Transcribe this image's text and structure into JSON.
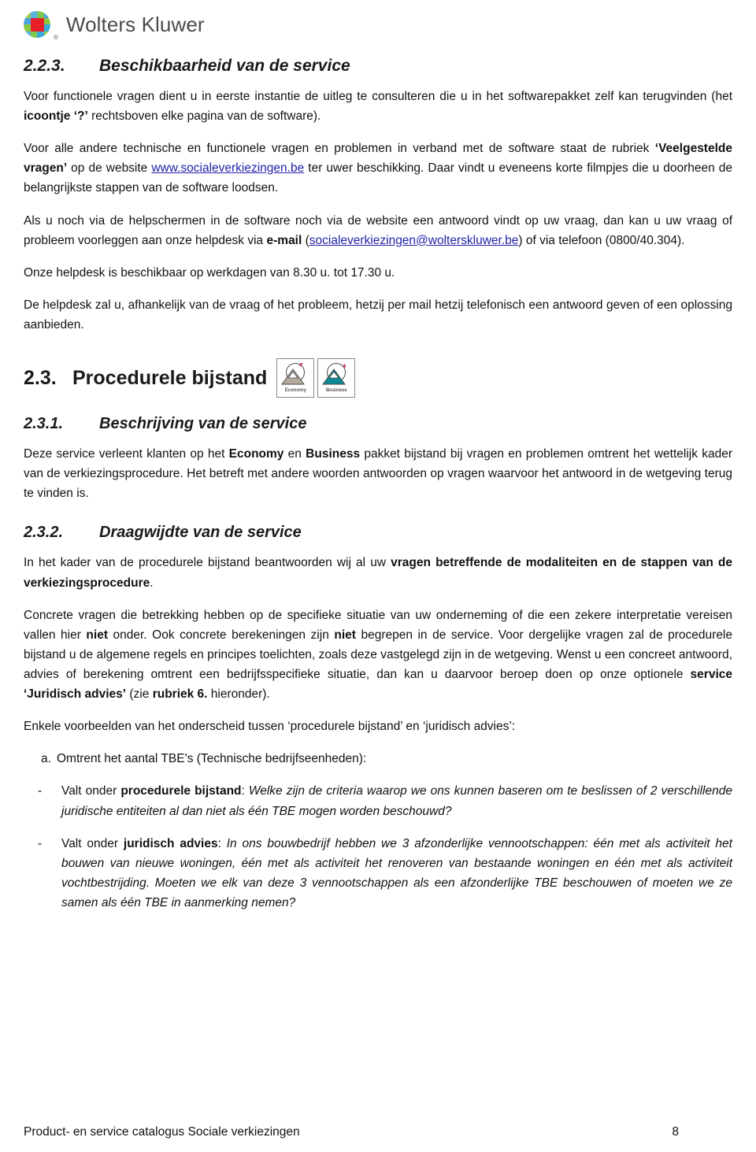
{
  "brand": {
    "name": "Wolters Kluwer",
    "registered_mark": "®",
    "logo_colors": [
      "#8cc63f",
      "#4aa3df",
      "#6fbf4a",
      "#39a9dc",
      "#a4d65e",
      "#2f9fd6",
      "#7ec850",
      "#e8202a"
    ],
    "accent_red": "#e8202a"
  },
  "sections": {
    "s223": {
      "number": "2.2.3.",
      "title": "Beschikbaarheid van de service",
      "p1_a": "Voor functionele vragen dient u in eerste instantie de uitleg te consulteren die u in het softwarepakket zelf kan terugvinden (het ",
      "p1_bold": "icoontje ‘?’",
      "p1_b": " rechtsboven elke pagina van de software).",
      "p2_a": "Voor alle andere technische en functionele vragen en problemen in verband met de software staat  de rubriek ",
      "p2_bold": "‘Veelgestelde vragen’",
      "p2_b": " op de website ",
      "p2_link": "www.socialeverkiezingen.be",
      "p2_c": " ter uwer beschikking. Daar vindt u eveneens korte filmpjes die u doorheen de belangrijkste stappen van de software loodsen.",
      "p3_a": "Als u noch via de helpschermen in de software noch via de website een antwoord vindt op uw vraag, dan kan u uw vraag of probleem voorleggen aan onze helpdesk via ",
      "p3_bold": "e-mail",
      "p3_b": " (",
      "p3_link": "socialeverkiezingen@wolterskluwer.be",
      "p3_c": ") of via telefoon (0800/40.304).",
      "p4": "Onze helpdesk is beschikbaar op werkdagen van 8.30 u. tot 17.30 u.",
      "p5": "De helpdesk zal u, afhankelijk van de vraag of het probleem, hetzij per mail hetzij telefonisch een antwoord geven of een oplossing aanbieden."
    },
    "s23": {
      "number": "2.3.",
      "title": "Procedurele bijstand",
      "icons": [
        {
          "label": "Economy",
          "mountain_color": "#b5aca0",
          "name": "economy-package-icon"
        },
        {
          "label": "Business",
          "mountain_color": "#0e8a96",
          "name": "business-package-icon"
        }
      ]
    },
    "s231": {
      "number": "2.3.1.",
      "title": "Beschrijving van de service",
      "p1_a": "Deze service verleent klanten op het ",
      "p1_bold1": "Economy",
      "p1_mid": " en ",
      "p1_bold2": "Business",
      "p1_b": " pakket bijstand bij vragen en problemen omtrent het wettelijk kader van de verkiezingsprocedure. Het betreft met andere woorden antwoorden op vragen waarvoor het antwoord in de wetgeving terug te vinden is."
    },
    "s232": {
      "number": "2.3.2.",
      "title": "Draagwijdte van de service",
      "p1_a": "In het kader van de procedurele bijstand beantwoorden wij al uw ",
      "p1_bold": "vragen betreffende de modaliteiten en de stappen van de verkiezingsprocedure",
      "p1_b": ".",
      "p2_a": "Concrete vragen die betrekking hebben op de specifieke situatie van uw onderneming of die een zekere interpretatie vereisen vallen hier ",
      "p2_bold1": "niet",
      "p2_b": " onder.  Ook concrete berekeningen zijn ",
      "p2_bold2": "niet",
      "p2_c": " begrepen in de service. Voor dergelijke vragen zal de procedurele bijstand u de algemene regels en principes toelichten, zoals deze vastgelegd zijn in de wetgeving. Wenst u een concreet antwoord, advies of berekening omtrent een bedrijfsspecifieke situatie, dan kan u daarvoor beroep doen op onze optionele ",
      "p2_bold3": "service ‘Juridisch advies’",
      "p2_d": " (zie ",
      "p2_bold4": "rubriek 6.",
      "p2_e": " hieronder).",
      "p3": "Enkele voorbeelden van het onderscheid tussen ‘procedurele bijstand’ en ‘juridisch advies’:",
      "item_a_marker": "a.",
      "item_a_text": "Omtrent het aantal TBE’s (Technische bedrijfseenheden):",
      "bullet1_marker": "-",
      "bullet1_a": "Valt onder ",
      "bullet1_bold": "procedurele bijstand",
      "bullet1_b": ": ",
      "bullet1_italic": "Welke zijn de criteria waarop we ons kunnen baseren om te beslissen of 2 verschillende juridische entiteiten al dan niet als één TBE mogen worden beschouwd?",
      "bullet2_marker": "-",
      "bullet2_a": "Valt onder ",
      "bullet2_bold": "juridisch advies",
      "bullet2_b": ": ",
      "bullet2_italic": "In ons bouwbedrijf hebben we 3 afzonderlijke vennootschappen: één met als activiteit het bouwen van nieuwe woningen, één met als activiteit het renoveren van bestaande woningen en één met als activiteit vochtbestrijding. Moeten we elk van deze 3 vennootschappen als een afzonderlijke TBE beschouwen of moeten we ze samen als één TBE in aanmerking nemen?"
    }
  },
  "footer": {
    "title": "Product- en service catalogus Sociale verkiezingen",
    "page_number": "8"
  }
}
